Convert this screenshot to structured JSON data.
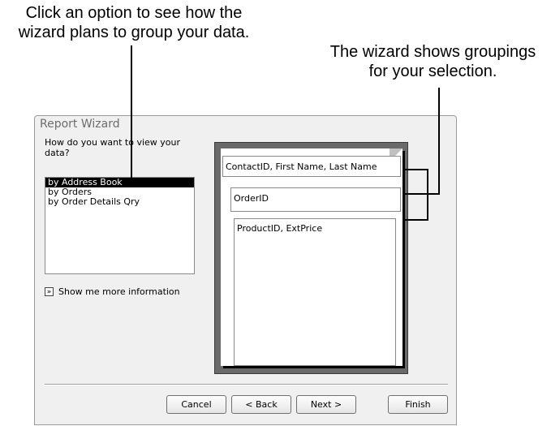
{
  "callouts": {
    "left_line1": "Click an option to see how the",
    "left_line2": "wizard plans to group your data.",
    "right_line1": "The wizard shows groupings",
    "right_line2": "for your selection."
  },
  "dialog": {
    "title": "Report Wizard",
    "prompt_line1": "How do you want to view your",
    "prompt_line2": "data?",
    "options": [
      "by Address Book",
      "by Orders",
      "by Order Details Qry"
    ],
    "selected_option": "by Address Book",
    "more_info_icon": "double-chevron-right-icon",
    "more_info_label": "Show me more information",
    "preview": {
      "groups": [
        "ContactID, First Name, Last Name",
        "OrderID",
        "ProductID, ExtPrice"
      ]
    },
    "buttons": {
      "cancel": "Cancel",
      "back": "< Back",
      "next": "Next >",
      "finish": "Finish"
    }
  }
}
